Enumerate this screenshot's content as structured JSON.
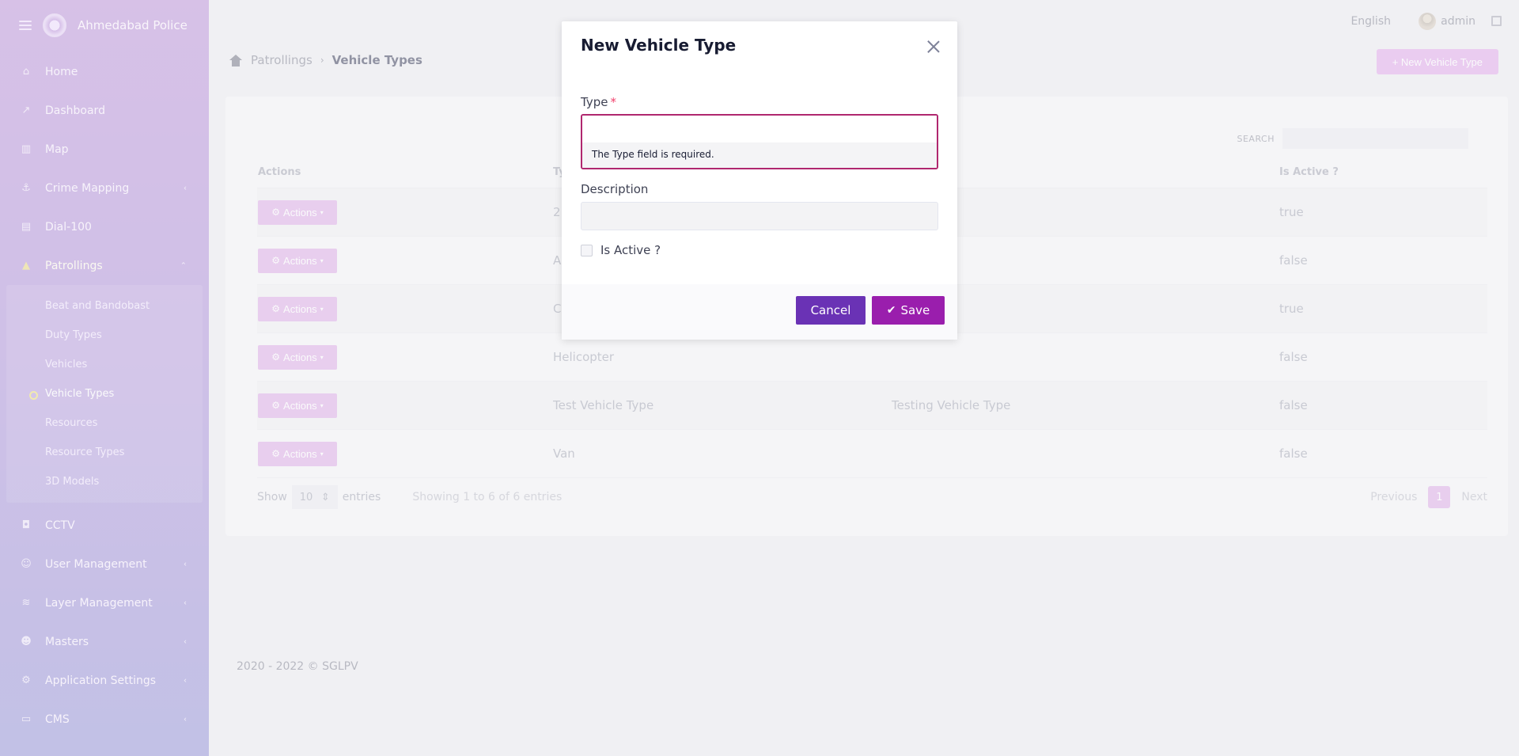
{
  "sidebar": {
    "brand": "Ahmedabad Police",
    "items": [
      {
        "label": "Home",
        "icon": "home-icon"
      },
      {
        "label": "Dashboard",
        "icon": "chart-icon"
      },
      {
        "label": "Map",
        "icon": "map-icon"
      },
      {
        "label": "Crime Mapping",
        "icon": "crime-icon",
        "chevron": "‹"
      },
      {
        "label": "Dial-100",
        "icon": "phone-icon"
      },
      {
        "label": "Patrollings",
        "icon": "road-icon",
        "chevron": "⌃"
      }
    ],
    "patrolling_sub": [
      {
        "label": "Beat and Bandobast"
      },
      {
        "label": "Duty Types"
      },
      {
        "label": "Vehicles"
      },
      {
        "label": "Vehicle Types",
        "active": true
      },
      {
        "label": "Resources"
      },
      {
        "label": "Resource Types"
      },
      {
        "label": "3D Models"
      }
    ],
    "items_after": [
      {
        "label": "CCTV",
        "icon": "camera-icon"
      },
      {
        "label": "User Management",
        "icon": "users-icon",
        "chevron": "‹"
      },
      {
        "label": "Layer Management",
        "icon": "layers-icon",
        "chevron": "‹"
      },
      {
        "label": "Masters",
        "icon": "group-icon",
        "chevron": "‹"
      },
      {
        "label": "Application Settings",
        "icon": "cogs-icon",
        "chevron": "‹"
      },
      {
        "label": "CMS",
        "icon": "cms-icon",
        "chevron": "‹"
      }
    ]
  },
  "topbar": {
    "language": "English",
    "user": "admin"
  },
  "breadcrumb": {
    "parent": "Patrollings",
    "sep": "›",
    "current": "Vehicle Types"
  },
  "header": {
    "new_button": "+ New Vehicle Type"
  },
  "table": {
    "search_label": "SEARCH",
    "columns": [
      "Actions",
      "Ty",
      "",
      "Is Active ?"
    ],
    "action_label": "Actions",
    "rows": [
      {
        "type": "2",
        "description": "",
        "active": "true"
      },
      {
        "type": "A",
        "description": "",
        "active": "false"
      },
      {
        "type": "C",
        "description": "",
        "active": "true"
      },
      {
        "type": "Helicopter",
        "description": "",
        "active": "false"
      },
      {
        "type": "Test Vehicle Type",
        "description": "Testing Vehicle Type",
        "active": "false"
      },
      {
        "type": "Van",
        "description": "",
        "active": "false"
      }
    ],
    "show": "Show",
    "page_length": "10",
    "entries": "entries",
    "info": "Showing 1 to 6 of 6 entries",
    "previous": "Previous",
    "page": "1",
    "next": "Next"
  },
  "footer": {
    "copyright": "2020 - 2022 © SGLPV"
  },
  "modal": {
    "title": "New Vehicle Type",
    "type_label": "Type",
    "required_mark": "*",
    "type_value": "",
    "type_error": "The Type field is required.",
    "description_label": "Description",
    "description_value": "",
    "is_active_label": "Is Active ?",
    "cancel": "Cancel",
    "save": "Save"
  },
  "colors": {
    "accent": "#9a1ead",
    "cancel": "#6a32b5",
    "error_border": "#b0276f",
    "required": "#f1416c"
  }
}
